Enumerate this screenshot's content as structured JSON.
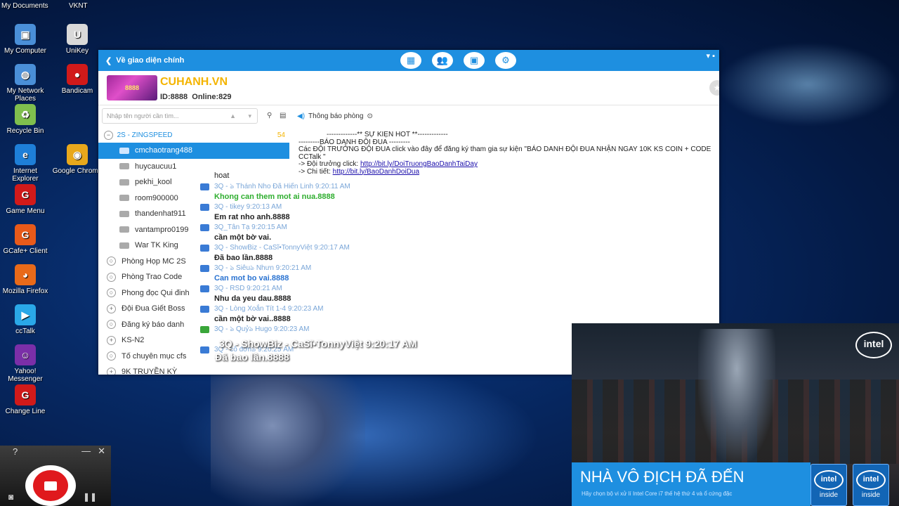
{
  "desktop": {
    "top_items": [
      "My Documents",
      "VKNT"
    ],
    "icons": [
      {
        "label": "My Computer",
        "color": "#4a8fd8",
        "glyph": "▣"
      },
      {
        "label": "UniKey",
        "color": "#d9d9d9",
        "glyph": "U"
      },
      {
        "label": "My Network Places",
        "color": "#4a8fd8",
        "glyph": "◍"
      },
      {
        "label": "Bandicam",
        "color": "#d11a1a",
        "glyph": "●"
      },
      {
        "label": "Recycle Bin",
        "color": "#7fbf4e",
        "glyph": "♻"
      },
      {
        "label": "Internet Explorer",
        "color": "#1e7fd8",
        "glyph": "e"
      },
      {
        "label": "Google Chrome",
        "color": "#e8a81c",
        "glyph": "◉"
      },
      {
        "label": "Game Menu",
        "color": "#d11a1a",
        "glyph": "G"
      },
      {
        "label": "GCafe+ Client",
        "color": "#e85a1a",
        "glyph": "G"
      },
      {
        "label": "Mozilla Firefox",
        "color": "#e86a1a",
        "glyph": "◕"
      },
      {
        "label": "ccTalk",
        "color": "#2aa8e8",
        "glyph": "▶"
      },
      {
        "label": "Yahoo! Messenger",
        "color": "#7b2fa8",
        "glyph": "☺"
      },
      {
        "label": "Change Line",
        "color": "#d11a1a",
        "glyph": "G"
      }
    ]
  },
  "window": {
    "back_label": "Về giao diện chính",
    "room": {
      "name": "CUHANH.VN",
      "id_text": "ID:8888",
      "online_text": "Online:829",
      "thumb_text": "8888"
    },
    "search_placeholder": "Nhập tên người cần tìm...",
    "notice_label": "Thông báo phòng",
    "group": {
      "name": "2S - ZINGSPEED",
      "count": "54"
    },
    "members": [
      "cmchaotrang488",
      "huycaucuu1",
      "pekhi_kool",
      "room900000",
      "thandenhat911",
      "vantampro0199",
      "War TK King"
    ],
    "rooms": [
      {
        "name": "Phòng Họp MC 2S",
        "icon": "○"
      },
      {
        "name": "Phòng Trao Code",
        "icon": "○"
      },
      {
        "name": "Phong đọc Qui đinh",
        "icon": "○"
      },
      {
        "name": "Đội Đua Giết Boss",
        "icon": "+"
      },
      {
        "name": "Đăng ký báo danh",
        "icon": "○"
      },
      {
        "name": "KS-N2",
        "icon": "+"
      },
      {
        "name": "Tố chuyên mục cfs",
        "icon": "○"
      },
      {
        "name": "9K TRUYỀN KỲ",
        "icon": "+"
      }
    ],
    "system_message": {
      "line1": "-------------** SỰ KIỆN HOT **-------------",
      "line2": "---------BÁO DANH ĐỘI ĐUA ---------",
      "line3": "Các ĐỘI TRƯỞNG ĐỘI ĐUA click vào đây để đăng ký tham gia sự kiện \"BÁO DANH ĐỘI ĐUA NHẬN NGAY 10K KS COIN + CODE CCTalk \"",
      "line4_prefix": "-> Đội trưởng click: ",
      "line4_link": "http://bit.ly/DoiTruongBaoDanhTaiDay",
      "line5_prefix": "-> Chi tiết: ",
      "line5_link": "http://bit.ly/BaoDanhDoiDua"
    },
    "messages": [
      {
        "header": "",
        "body": "hoat",
        "style": "plain"
      },
      {
        "header": "3Q - ঌ   Thánh Nho Đã Hiến Linh   9:20:11 AM",
        "body": "Khong can them mot ai nua.8888",
        "style": "green"
      },
      {
        "header": "3Q - tikey  9:20:13 AM",
        "body": "Em rat nho anh.8888",
        "style": "plain"
      },
      {
        "header": "3Q_Tân Tạ 9:20:15 AM",
        "body": "cần một bờ vai.",
        "style": "plain"
      },
      {
        "header": "3Q - ShowBiz - CaSĩ•TonnyViệt 9:20:17 AM",
        "body": "Đã bao lần.8888",
        "style": "plain"
      },
      {
        "header": "3Q - ঌ   Siêuঌ     Nhưn     9:20:21 AM",
        "body": "Can mot bo vai.8888",
        "style": "blue"
      },
      {
        "header": "3Q - RSD 9:20:21 AM",
        "body": "Nhu da yeu dau.8888",
        "style": "plain"
      },
      {
        "header": "3Q - Lòng Xoắn Tít 1-4 9:20:23 AM",
        "body": "cần một bờ vai..8888",
        "style": "plain"
      },
      {
        "header": "3Q - ঌ    Quỷঌ     Hugo     9:20:23 AM",
        "body": "",
        "style": "plain"
      },
      {
        "header": "3Q - cô đơnঌ 9:20:25 AM",
        "body": "",
        "style": "plain"
      }
    ],
    "overlay": {
      "line1": "3Q -  ShowBiz - CaSĩ•TonnyViệt 9:20:17 AM",
      "line2": "Đã bao lần.8888"
    }
  },
  "intel_ad": {
    "logo": "intel",
    "headline": "NHÀ VÔ ĐỊCH ĐÃ ĐẾN",
    "subtext": "Hãy chọn bộ vi xử lí Intel Core i7 thế hệ thứ 4 và ổ cứng đặc",
    "chips": [
      {
        "logo": "intel",
        "label": "inside"
      },
      {
        "logo": "intel",
        "label": "inside"
      }
    ]
  },
  "recorder": {
    "help": "?",
    "minimize": "—",
    "close": "✕"
  }
}
